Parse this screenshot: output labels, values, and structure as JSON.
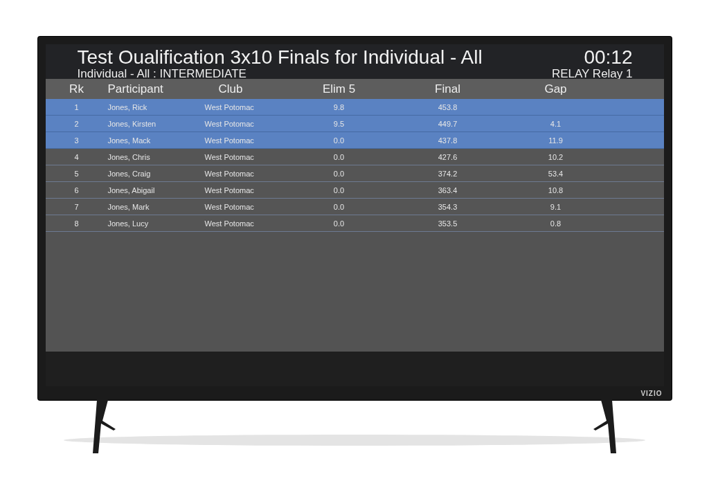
{
  "header": {
    "title": "Test Oualification 3x10 Finals for Individual - All",
    "subtitle": "Individual - All : INTERMEDIATE",
    "clock": "00:12",
    "relay": "RELAY Relay 1"
  },
  "table": {
    "columns": [
      "Rk",
      "Participant",
      "Club",
      "Elim 5",
      "Final",
      "Gap"
    ],
    "rows": [
      {
        "highlighted": true,
        "cells": [
          "1",
          "Jones, Rick",
          "West Potomac",
          "9.8",
          "453.8",
          ""
        ]
      },
      {
        "highlighted": true,
        "cells": [
          "2",
          "Jones, Kirsten",
          "West Potomac",
          "9.5",
          "449.7",
          "4.1"
        ]
      },
      {
        "highlighted": true,
        "cells": [
          "3",
          "Jones, Mack",
          "West Potomac",
          "0.0",
          "437.8",
          "11.9"
        ]
      },
      {
        "highlighted": false,
        "cells": [
          "4",
          "Jones, Chris",
          "West Potomac",
          "0.0",
          "427.6",
          "10.2"
        ]
      },
      {
        "highlighted": false,
        "cells": [
          "5",
          "Jones, Craig",
          "West Potomac",
          "0.0",
          "374.2",
          "53.4"
        ]
      },
      {
        "highlighted": false,
        "cells": [
          "6",
          "Jones, Abigail",
          "West Potomac",
          "0.0",
          "363.4",
          "10.8"
        ]
      },
      {
        "highlighted": false,
        "cells": [
          "7",
          "Jones, Mark",
          "West Potomac",
          "0.0",
          "354.3",
          "9.1"
        ]
      },
      {
        "highlighted": false,
        "cells": [
          "8",
          "Jones, Lucy",
          "West Potomac",
          "0.0",
          "353.5",
          "0.8"
        ]
      }
    ]
  },
  "tv": {
    "brand_logo": "VIZIO"
  }
}
